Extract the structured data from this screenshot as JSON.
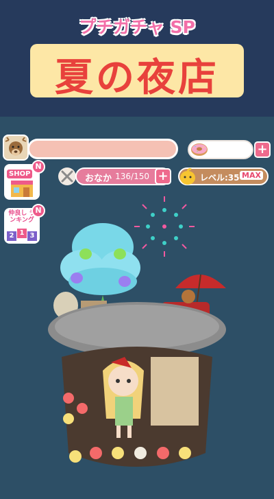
{
  "banner": {
    "subtitle": "プチガチャ SP",
    "title": "夏の夜店"
  },
  "hud": {
    "avatar_icon": "reindeer-avatar-icon",
    "donut_icon": "donut-icon",
    "plus": "+",
    "shop": {
      "label": "SHOP",
      "badge": "N"
    },
    "hunger": {
      "label": "おなか",
      "value": "136/150",
      "plus": "+"
    },
    "level": {
      "label": "レベル:35",
      "max": "MAX"
    },
    "ranking": {
      "label": "仲良し ランキング",
      "numbers": [
        "2",
        "1",
        "3"
      ],
      "badge": "N"
    }
  },
  "colors": {
    "banner_bg": "#263a5c",
    "scene_bg": "#2d4f66",
    "title_red": "#e8413c",
    "subtitle_pink": "#f26fa8",
    "accent_pink": "#ee6a8d"
  }
}
